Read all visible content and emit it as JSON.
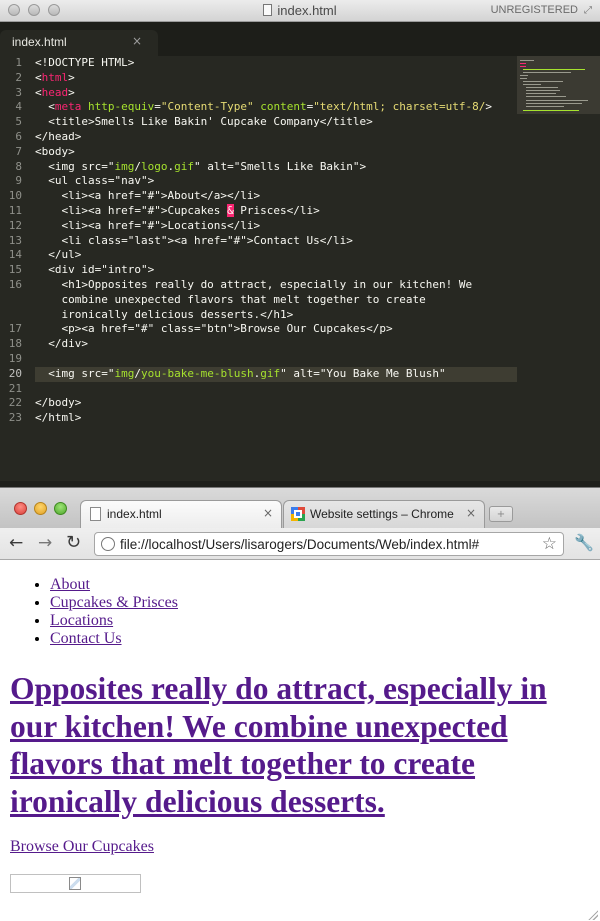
{
  "editor": {
    "window_title": "index.html",
    "license_status": "UNREGISTERED",
    "tab_label": "index.html",
    "tab_close": "×",
    "highlighted_line": 20,
    "lines": [
      {
        "n": "1",
        "tokens": [
          [
            "w",
            "<!DOCTYPE HTML>"
          ]
        ]
      },
      {
        "n": "2",
        "tokens": [
          [
            "w",
            "<"
          ],
          [
            "t",
            "html"
          ],
          [
            "w",
            ">"
          ]
        ]
      },
      {
        "n": "3",
        "tokens": [
          [
            "w",
            "<"
          ],
          [
            "t",
            "head"
          ],
          [
            "w",
            ">"
          ]
        ]
      },
      {
        "n": "4",
        "tokens": [
          [
            "w",
            "  <"
          ],
          [
            "t",
            "meta"
          ],
          [
            "w",
            " "
          ],
          [
            "a",
            "http-equiv"
          ],
          [
            "w",
            "="
          ],
          [
            "s",
            "\"Content-Type\""
          ],
          [
            "w",
            " "
          ],
          [
            "a",
            "content"
          ],
          [
            "w",
            "="
          ],
          [
            "s",
            "\"text/html; charset=utf-8/"
          ],
          [
            "w",
            ">"
          ]
        ]
      },
      {
        "n": "5",
        "tokens": [
          [
            "w",
            "  <title>Smells Like Bakin' Cupcake Company</title>"
          ]
        ]
      },
      {
        "n": "6",
        "tokens": [
          [
            "w",
            "</head>"
          ]
        ]
      },
      {
        "n": "7",
        "tokens": [
          [
            "w",
            "<body>"
          ]
        ]
      },
      {
        "n": "8",
        "tokens": [
          [
            "w",
            "  <img src=\""
          ],
          [
            "a",
            "img"
          ],
          [
            "w",
            "/"
          ],
          [
            "a",
            "logo"
          ],
          [
            "w",
            "."
          ],
          [
            "a",
            "gif"
          ],
          [
            "w",
            "\" alt=\"Smells Like Bakin\">"
          ]
        ]
      },
      {
        "n": "9",
        "tokens": [
          [
            "w",
            "  <ul class=\"nav\">"
          ]
        ]
      },
      {
        "n": "10",
        "tokens": [
          [
            "w",
            "    <li><a href=\"#\">About</a></li>"
          ]
        ]
      },
      {
        "n": "11",
        "tokens": [
          [
            "w",
            "    <li><a href=\"#\">Cupcakes "
          ],
          [
            "amp",
            "&"
          ],
          [
            "w",
            " Prisces</li>"
          ]
        ]
      },
      {
        "n": "12",
        "tokens": [
          [
            "w",
            "    <li><a href=\"#\">Locations</li>"
          ]
        ]
      },
      {
        "n": "13",
        "tokens": [
          [
            "w",
            "    <li class=\"last\"><a href=\"#\">Contact Us</li>"
          ]
        ]
      },
      {
        "n": "14",
        "tokens": [
          [
            "w",
            "  </ul>"
          ]
        ]
      },
      {
        "n": "15",
        "tokens": [
          [
            "w",
            "  <div id=\"intro\">"
          ]
        ]
      },
      {
        "n": "16",
        "tokens": [
          [
            "w",
            "    <h1>Opposites really do attract, especially in our kitchen! We"
          ]
        ]
      },
      {
        "n": "",
        "tokens": [
          [
            "w",
            "    combine unexpected flavors that melt together to create"
          ]
        ]
      },
      {
        "n": "",
        "tokens": [
          [
            "w",
            "    ironically delicious desserts.</h1>"
          ]
        ]
      },
      {
        "n": "17",
        "tokens": [
          [
            "w",
            "    <p><a href=\"#\" class=\"btn\">Browse Our Cupcakes</p>"
          ]
        ]
      },
      {
        "n": "18",
        "tokens": [
          [
            "w",
            "  </div>"
          ]
        ]
      },
      {
        "n": "19",
        "tokens": [
          [
            "w",
            ""
          ]
        ]
      },
      {
        "n": "20",
        "tokens": [
          [
            "w",
            "  <img src=\""
          ],
          [
            "a",
            "img"
          ],
          [
            "w",
            "/"
          ],
          [
            "a",
            "you-bake-me-blush"
          ],
          [
            "w",
            "."
          ],
          [
            "a",
            "gif"
          ],
          [
            "w",
            "\" alt=\"You Bake Me Blush\""
          ]
        ]
      },
      {
        "n": "21",
        "tokens": [
          [
            "w",
            ""
          ]
        ]
      },
      {
        "n": "22",
        "tokens": [
          [
            "w",
            "</body>"
          ]
        ]
      },
      {
        "n": "23",
        "tokens": [
          [
            "w",
            "</html>"
          ]
        ]
      }
    ]
  },
  "browser": {
    "tabs": [
      {
        "label": "index.html",
        "close": "×"
      },
      {
        "label": "Website settings – Chrome H",
        "close": "×"
      }
    ],
    "url": "file://localhost/Users/lisarogers/Documents/Web/index.html#",
    "page": {
      "nav": [
        "About",
        "Cupcakes & Prisces",
        "Locations",
        "Contact Us"
      ],
      "heading": "Opposites really do attract, especially in our kitchen! We combine unexpected flavors that melt together to create ironically delicious desserts.",
      "button_link": "Browse Our Cupcakes"
    }
  },
  "icons": {
    "back": "back-arrow-icon",
    "forward": "forward-arrow-icon",
    "reload": "reload-icon",
    "star": "bookmark-star-icon",
    "wrench": "wrench-menu-icon"
  },
  "colors": {
    "editor_bg": "#272822",
    "keyword": "#f92672",
    "attribute": "#a6e22e",
    "string": "#e6db74",
    "visited_link": "#551a8b"
  }
}
